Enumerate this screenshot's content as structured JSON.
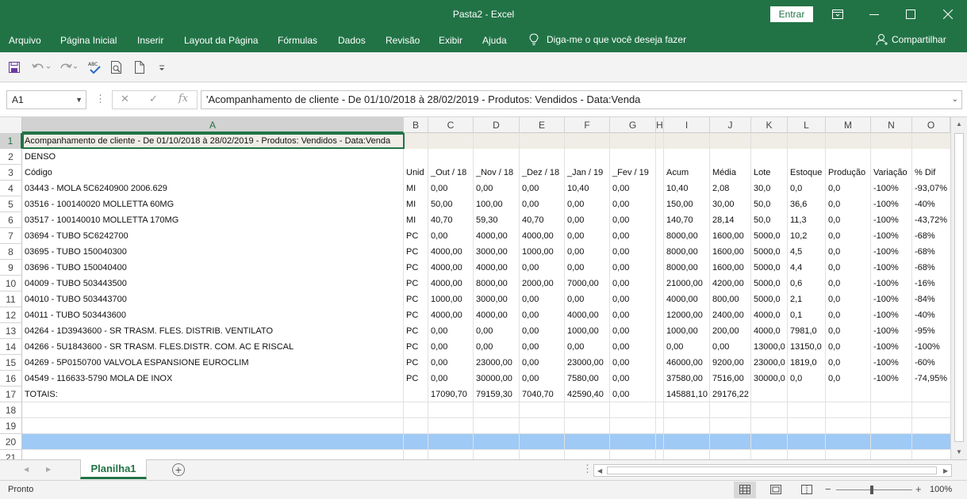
{
  "window": {
    "title": "Pasta2  -  Excel",
    "signin_label": "Entrar"
  },
  "ribbon": {
    "tabs": [
      "Arquivo",
      "Página Inicial",
      "Inserir",
      "Layout da Página",
      "Fórmulas",
      "Dados",
      "Revisão",
      "Exibir",
      "Ajuda"
    ],
    "tell_me": "Diga-me o que você deseja fazer",
    "share": "Compartilhar"
  },
  "formula_bar": {
    "name_box": "A1",
    "formula": "'Acompanhamento de cliente - De 01/10/2018 à 28/02/2019 - Produtos: Vendidos - Data:Venda"
  },
  "sheet": {
    "columns": [
      "A",
      "B",
      "C",
      "D",
      "E",
      "F",
      "G",
      "H",
      "I",
      "J",
      "K",
      "L",
      "M",
      "N",
      "O"
    ],
    "row_numbers": [
      "1",
      "2",
      "3",
      "4",
      "5",
      "6",
      "7",
      "8",
      "9",
      "10",
      "11",
      "12",
      "13",
      "14",
      "15",
      "16",
      "17",
      "18",
      "19",
      "20",
      "21"
    ],
    "rows": [
      [
        "Acompanhamento de cliente - De 01/10/2018 à 28/02/2019 - Produtos: Vendidos - Data:Venda"
      ],
      [
        "DENSO"
      ],
      [
        "Código",
        "Unid",
        "_Out / 18",
        "_Nov / 18",
        "_Dez / 18",
        "_Jan / 19",
        "_Fev / 19",
        "",
        "Acum",
        "Média",
        "Lote",
        "Estoque",
        "Produção",
        "Variação",
        "% Dif"
      ],
      [
        "03443 - MOLA 5C6240900  2006.629",
        "MI",
        "0,00",
        "0,00",
        "0,00",
        "10,40",
        "0,00",
        "",
        "10,40",
        "2,08",
        "30,0",
        "0,0",
        "0,0",
        "-100%",
        "-93,07%"
      ],
      [
        "03516 - 100140020 MOLLETTA 60MG",
        "MI",
        "50,00",
        "100,00",
        "0,00",
        "0,00",
        "0,00",
        "",
        "150,00",
        "30,00",
        "50,0",
        "36,6",
        "0,0",
        "-100%",
        "-40%"
      ],
      [
        "03517 - 100140010 MOLLETTA 170MG",
        "MI",
        "40,70",
        "59,30",
        "40,70",
        "0,00",
        "0,00",
        "",
        "140,70",
        "28,14",
        "50,0",
        "11,3",
        "0,0",
        "-100%",
        "-43,72%"
      ],
      [
        "03694 - TUBO 5C6242700",
        "PC",
        "0,00",
        "4000,00",
        "4000,00",
        "0,00",
        "0,00",
        "",
        "8000,00",
        "1600,00",
        "5000,0",
        "10,2",
        "0,0",
        "-100%",
        "-68%"
      ],
      [
        "03695 - TUBO 150040300",
        "PC",
        "4000,00",
        "3000,00",
        "1000,00",
        "0,00",
        "0,00",
        "",
        "8000,00",
        "1600,00",
        "5000,0",
        "4,5",
        "0,0",
        "-100%",
        "-68%"
      ],
      [
        "03696 - TUBO 150040400",
        "PC",
        "4000,00",
        "4000,00",
        "0,00",
        "0,00",
        "0,00",
        "",
        "8000,00",
        "1600,00",
        "5000,0",
        "4,4",
        "0,0",
        "-100%",
        "-68%"
      ],
      [
        "04009 - TUBO 503443500",
        "PC",
        "4000,00",
        "8000,00",
        "2000,00",
        "7000,00",
        "0,00",
        "",
        "21000,00",
        "4200,00",
        "5000,0",
        "0,6",
        "0,0",
        "-100%",
        "-16%"
      ],
      [
        "04010 - TUBO 503443700",
        "PC",
        "1000,00",
        "3000,00",
        "0,00",
        "0,00",
        "0,00",
        "",
        "4000,00",
        "800,00",
        "5000,0",
        "2,1",
        "0,0",
        "-100%",
        "-84%"
      ],
      [
        "04011 - TUBO 503443600",
        "PC",
        "4000,00",
        "4000,00",
        "0,00",
        "4000,00",
        "0,00",
        "",
        "12000,00",
        "2400,00",
        "4000,0",
        "0,1",
        "0,0",
        "-100%",
        "-40%"
      ],
      [
        "04264 - 1D3943600 - SR TRASM. FLES. DISTRIB. VENTILATO",
        "PC",
        "0,00",
        "0,00",
        "0,00",
        "1000,00",
        "0,00",
        "",
        "1000,00",
        "200,00",
        "4000,0",
        "7981,0",
        "0,0",
        "-100%",
        "-95%"
      ],
      [
        "04266 - 5U1843600 - SR TRASM. FLES.DISTR. COM. AC E RISCAL",
        "PC",
        "0,00",
        "0,00",
        "0,00",
        "0,00",
        "0,00",
        "",
        "0,00",
        "0,00",
        "13000,0",
        "13150,0",
        "0,0",
        "-100%",
        "-100%"
      ],
      [
        "04269 - 5P0150700 VALVOLA ESPANSIONE EUROCLIM",
        "PC",
        "0,00",
        "23000,00",
        "0,00",
        "23000,00",
        "0,00",
        "",
        "46000,00",
        "9200,00",
        "23000,0",
        "1819,0",
        "0,0",
        "-100%",
        "-60%"
      ],
      [
        "04549 - 116633-5790 MOLA DE INOX",
        "PC",
        "0,00",
        "30000,00",
        "0,00",
        "7580,00",
        "0,00",
        "",
        "37580,00",
        "7516,00",
        "30000,0",
        "0,0",
        "0,0",
        "-100%",
        "-74,95%"
      ],
      [
        "TOTAIS:",
        "",
        "17090,70",
        "79159,30",
        "7040,70",
        "42590,40",
        "0,00",
        "",
        "145881,10",
        "29176,22",
        "",
        "",
        "",
        "",
        ""
      ]
    ]
  },
  "sheet_tab": "Planilha1",
  "status": {
    "text": "Pronto",
    "zoom": "100%"
  },
  "colors": {
    "accent": "#217346",
    "row20_highlight": "#9fcaf6"
  }
}
